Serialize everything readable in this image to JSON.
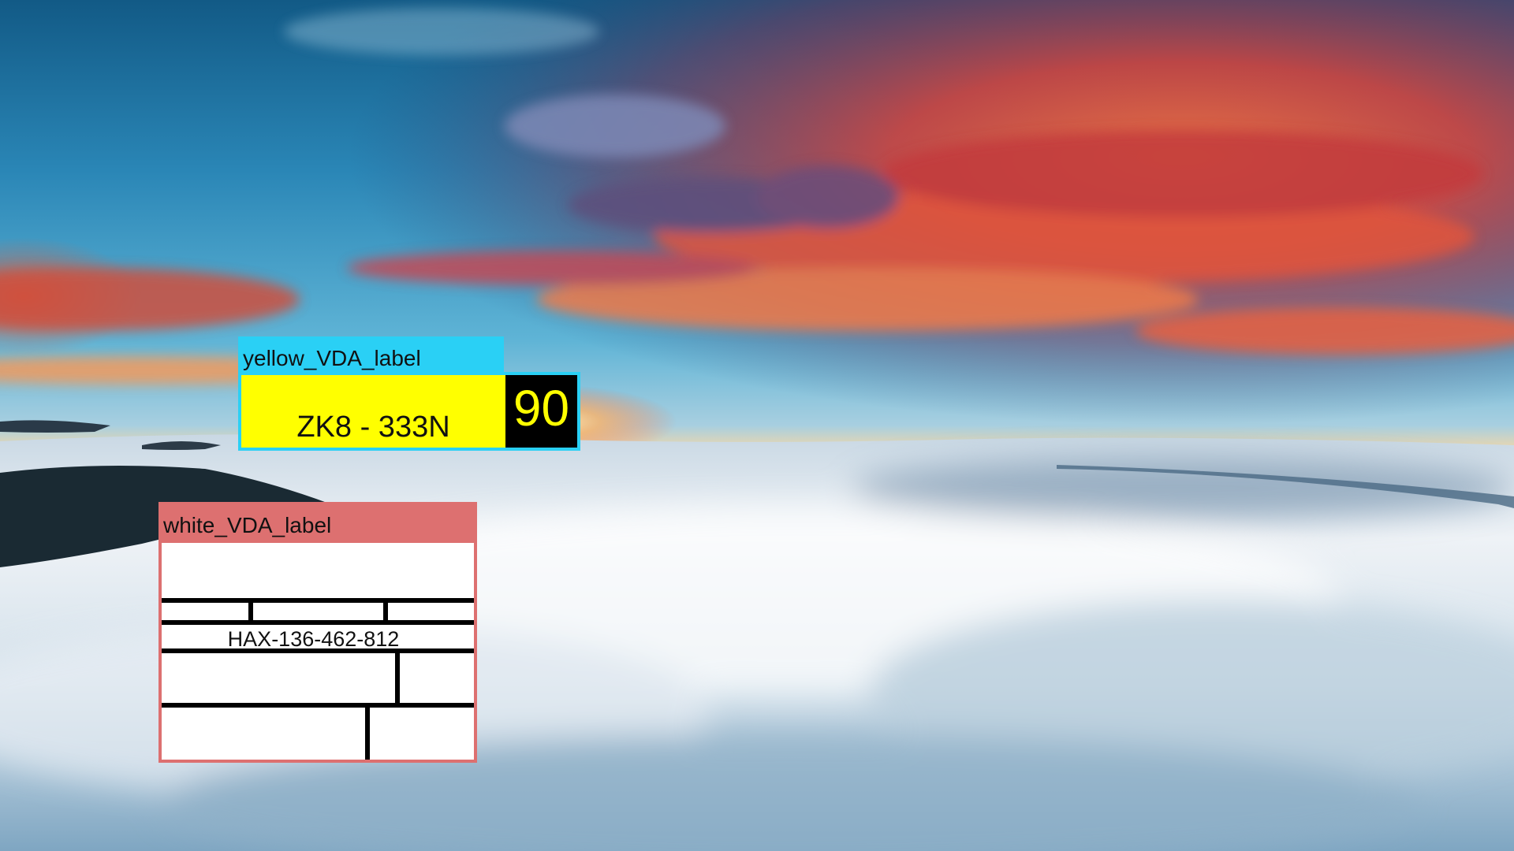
{
  "labels": {
    "yellow": {
      "title": "yellow_VDA_label",
      "plate_text": "ZK8 - 333N",
      "number": "90",
      "colors": {
        "title_bg": "#2ad0f5",
        "body_bg": "#ffff00",
        "number_bg": "#000000",
        "number_text": "#ffff00"
      }
    },
    "white": {
      "title": "white_VDA_label",
      "code": "HAX-136-462-812",
      "colors": {
        "title_bg": "#dd7070",
        "body_bg": "#ffffff",
        "rules": "#000000"
      }
    }
  },
  "background": {
    "scene": "sunset-sky-over-clouds",
    "colors": {
      "sky_top": "#1c6f9e",
      "sky_mid": "#4ba8cf",
      "sunset_red": "#e0503a",
      "sunset_orange": "#f28a3a",
      "horizon_glow": "#ffd27a",
      "cloud_light": "#e8eef4",
      "cloud_shadow": "#93b3cb",
      "mountain": "#1a2a33"
    }
  }
}
